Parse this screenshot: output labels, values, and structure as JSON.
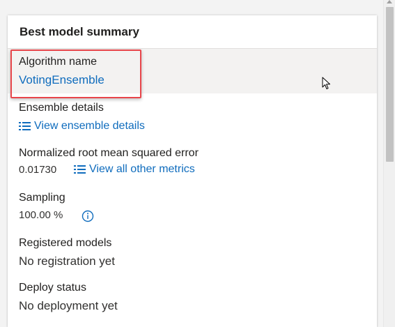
{
  "card": {
    "title": "Best model summary"
  },
  "fields": {
    "algorithm": {
      "label": "Algorithm name",
      "value": "VotingEnsemble"
    },
    "ensemble": {
      "label": "Ensemble details",
      "link": "View ensemble details"
    },
    "nrmse": {
      "label": "Normalized root mean squared error",
      "value": "0.01730",
      "link": "View all other metrics"
    },
    "sampling": {
      "label": "Sampling",
      "value": "100.00 %",
      "icon": "info-icon"
    },
    "registered": {
      "label": "Registered models",
      "value": "No registration yet"
    },
    "deploy": {
      "label": "Deploy status",
      "value": "No deployment yet"
    }
  },
  "colors": {
    "link": "#0f6cbd",
    "highlight_border": "#e8454a",
    "row_highlight": "#f3f2f1"
  }
}
